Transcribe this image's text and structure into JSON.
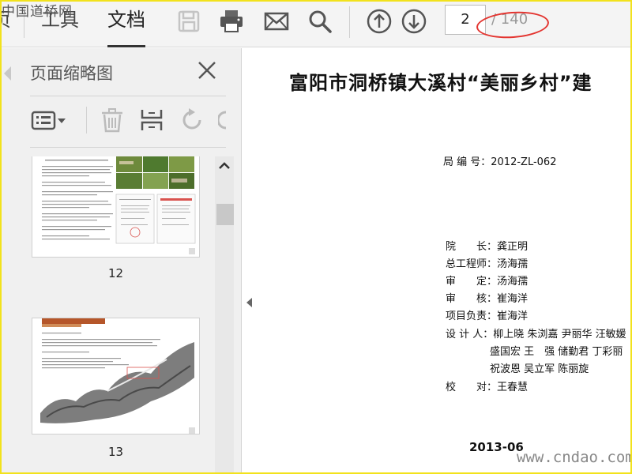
{
  "toolbar": {
    "tabs": [
      {
        "label": "页"
      },
      {
        "label": "工具"
      },
      {
        "label": "文档"
      }
    ],
    "icons": [
      "save-icon",
      "print-icon",
      "mail-icon",
      "search-icon",
      "prev-page-icon",
      "next-page-icon"
    ],
    "current_page": "2",
    "total_pages": "/ 140"
  },
  "watermark": {
    "top_left": "中国道桥网",
    "bottom_right": "www.cndao.com"
  },
  "thumbnail_panel": {
    "title": "页面缩略图",
    "thumbnails": [
      {
        "page_label": "12"
      },
      {
        "page_label": "13"
      }
    ]
  },
  "document": {
    "title": "富阳市洞桥镇大溪村“美丽乡村”建",
    "bureau_no_label": "局 编 号：",
    "bureau_no": "2012-ZL-062",
    "staff": [
      {
        "label": "院　　长：",
        "names": "龚正明"
      },
      {
        "label": "总工程师：",
        "names": "汤海孺"
      },
      {
        "label": "审　　定：",
        "names": "汤海孺"
      },
      {
        "label": "审　　核：",
        "names": "崔海洋"
      },
      {
        "label": "项目负责：",
        "names": "崔海洋"
      },
      {
        "label": "设 计 人：",
        "names": "柳上晓  朱浏嘉  尹丽华  汪敏媛"
      },
      {
        "label": "",
        "names": "盛国宏  王　强  储勤君  丁彩丽"
      },
      {
        "label": "",
        "names": "祝波恩  吴立军  陈丽旋"
      },
      {
        "label": "校　　对：",
        "names": "王春慧"
      }
    ],
    "date": "2013-06"
  },
  "colors": {
    "annotation_ellipse": "#e3342f",
    "frame": "#f2e21c",
    "active_tab_underline": "#333333"
  }
}
